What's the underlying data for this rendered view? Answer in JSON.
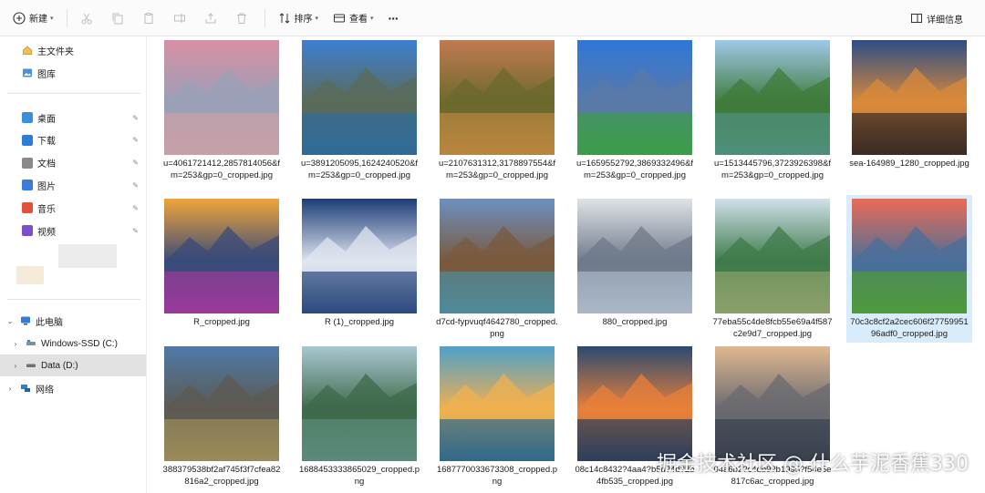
{
  "toolbar": {
    "new_label": "新建",
    "sort_label": "排序",
    "view_label": "查看",
    "more_label": "···",
    "details_label": "详细信息"
  },
  "sidebar": {
    "home": "主文件夹",
    "gallery": "图库",
    "quick": [
      {
        "label": "桌面",
        "icon": "desktop-icon",
        "color": "#3b8fd9"
      },
      {
        "label": "下载",
        "icon": "download-icon",
        "color": "#2d7dd2"
      },
      {
        "label": "文档",
        "icon": "document-icon",
        "color": "#8a8a8a"
      },
      {
        "label": "图片",
        "icon": "pictures-icon",
        "color": "#3d7bd6"
      },
      {
        "label": "音乐",
        "icon": "music-icon",
        "color": "#e2513a"
      },
      {
        "label": "视频",
        "icon": "video-icon",
        "color": "#7a4fc9"
      }
    ],
    "this_pc": "此电脑",
    "drive_c": "Windows-SSD (C:)",
    "drive_d": "Data (D:)",
    "network": "网络"
  },
  "files": [
    {
      "name": "u=4061721412,2857814056&fm=253&gp=0_cropped.jpg",
      "sky": "#d88fa3",
      "mid": "#9aa0b8",
      "ground": "#c7a0a8"
    },
    {
      "name": "u=3891205095,1624240520&fm=253&gp=0_cropped.jpg",
      "sky": "#3d7fd0",
      "mid": "#5a6b58",
      "ground": "#2f6b9a"
    },
    {
      "name": "u=2107631312,3178897554&fm=253&gp=0_cropped.jpg",
      "sky": "#c27a52",
      "mid": "#6b6a2d",
      "ground": "#b8863f"
    },
    {
      "name": "u=1659552792,3869332496&fm=253&gp=0_cropped.jpg",
      "sky": "#2f77d6",
      "mid": "#5a79a8",
      "ground": "#3c9c4a"
    },
    {
      "name": "u=1513445796,3723926398&fm=253&gp=0_cropped.jpg",
      "sky": "#9ec8e8",
      "mid": "#3f7b3a",
      "ground": "#4f8f7a"
    },
    {
      "name": "sea-164989_1280_cropped.jpg",
      "sky": "#2e4d86",
      "mid": "#d98a3a",
      "ground": "#3a2b24"
    },
    {
      "name": "R_cropped.jpg",
      "sky": "#f0a53a",
      "mid": "#394b7a",
      "ground": "#9a3a9a"
    },
    {
      "name": "R (1)_cropped.jpg",
      "sky": "#1e3d78",
      "mid": "#dfe6ef",
      "ground": "#2c4a80"
    },
    {
      "name": "d7cd-fypvuqf4642780_cropped.png",
      "sky": "#6d90c0",
      "mid": "#7a5a3c",
      "ground": "#4f8a9a"
    },
    {
      "name": "880_cropped.jpg",
      "sky": "#dfe3e8",
      "mid": "#6f7a8a",
      "ground": "#a9b7c6"
    },
    {
      "name": "77eba55c4de8fcb55e69a4f587c2e9d7_cropped.jpg",
      "sky": "#cfe0ea",
      "mid": "#3f7b4a",
      "ground": "#8aa06a"
    },
    {
      "name": "70c3c8cf2a2cec606f2775995196adf0_cropped.jpg",
      "sky": "#e96c55",
      "mid": "#4a6f9a",
      "ground": "#4f9a3a"
    },
    {
      "name": "388379538bf2af745f3f7cfea82816a2_cropped.jpg",
      "sky": "#4f7aa8",
      "mid": "#5c5a52",
      "ground": "#9a8a5a"
    },
    {
      "name": "1688453333865029_cropped.png",
      "sky": "#a8c8d2",
      "mid": "#3f6a4a",
      "ground": "#5a8a7a"
    },
    {
      "name": "1687770033673308_cropped.png",
      "sky": "#4fa0c8",
      "mid": "#f0b050",
      "ground": "#2f6a8a"
    },
    {
      "name": "08c14c8432?4aa4?b5d?4d?2b4fb535_cropped.jpg",
      "sky": "#2b4a70",
      "mid": "#e8803a",
      "ground": "#2c3f5a"
    },
    {
      "name": "04a6b2?c4db9?b1995?f54e5e817c6ac_cropped.jpg",
      "sky": "#e0b890",
      "mid": "#6a6a70",
      "ground": "#3a4150"
    }
  ],
  "watermark": "掘金技术社区 @ 什么芋泥香蕉330"
}
